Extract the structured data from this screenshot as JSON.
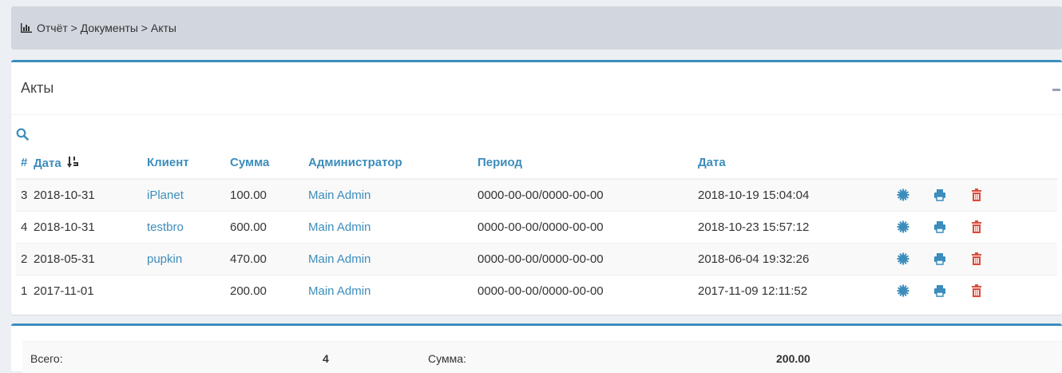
{
  "breadcrumb": {
    "text": "Отчёт > Документы > Акты",
    "icon": "bar-chart-icon"
  },
  "box": {
    "title": "Акты",
    "collapse_icon": "minus-icon",
    "search_icon": "search-icon"
  },
  "table": {
    "headers": {
      "num": "#",
      "date": "Дата",
      "client": "Клиент",
      "sum": "Сумма",
      "admin": "Администратор",
      "period": "Период",
      "created": "Дата"
    },
    "sort_icon": "sort-numeric-desc-icon",
    "rows": [
      {
        "num": "3",
        "date": "2018-10-31",
        "client": "iPlanet",
        "sum": "100.00",
        "admin": "Main Admin",
        "period": "0000-00-00/0000-00-00",
        "created": "2018-10-19 15:04:04"
      },
      {
        "num": "4",
        "date": "2018-10-31",
        "client": "testbro",
        "sum": "600.00",
        "admin": "Main Admin",
        "period": "0000-00-00/0000-00-00",
        "created": "2018-10-23 15:57:12"
      },
      {
        "num": "2",
        "date": "2018-05-31",
        "client": "pupkin",
        "sum": "470.00",
        "admin": "Main Admin",
        "period": "0000-00-00/0000-00-00",
        "created": "2018-06-04 19:32:26"
      },
      {
        "num": "1",
        "date": "2017-11-01",
        "client": "",
        "sum": "200.00",
        "admin": "Main Admin",
        "period": "0000-00-00/0000-00-00",
        "created": "2017-11-09 12:11:52"
      }
    ],
    "row_actions": [
      "gear-icon",
      "print-icon",
      "trash-icon"
    ]
  },
  "totals": {
    "total_label": "Всего:",
    "total_count": "4",
    "sum_label": "Сумма:",
    "sum_value": "200.00"
  },
  "colors": {
    "accent": "#3c8dbc",
    "danger": "#dd4b39",
    "breadcrumb_bg": "#d2d6de"
  }
}
